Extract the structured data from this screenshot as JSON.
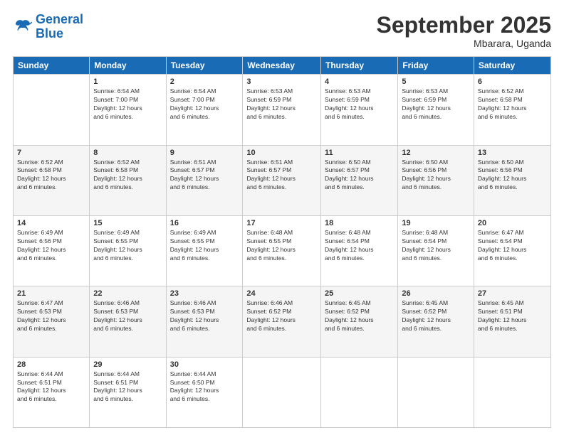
{
  "header": {
    "logo_line1": "General",
    "logo_line2": "Blue",
    "month": "September 2025",
    "location": "Mbarara, Uganda"
  },
  "weekdays": [
    "Sunday",
    "Monday",
    "Tuesday",
    "Wednesday",
    "Thursday",
    "Friday",
    "Saturday"
  ],
  "weeks": [
    [
      {
        "day": "",
        "info": ""
      },
      {
        "day": "1",
        "info": "Sunrise: 6:54 AM\nSunset: 7:00 PM\nDaylight: 12 hours\nand 6 minutes."
      },
      {
        "day": "2",
        "info": "Sunrise: 6:54 AM\nSunset: 7:00 PM\nDaylight: 12 hours\nand 6 minutes."
      },
      {
        "day": "3",
        "info": "Sunrise: 6:53 AM\nSunset: 6:59 PM\nDaylight: 12 hours\nand 6 minutes."
      },
      {
        "day": "4",
        "info": "Sunrise: 6:53 AM\nSunset: 6:59 PM\nDaylight: 12 hours\nand 6 minutes."
      },
      {
        "day": "5",
        "info": "Sunrise: 6:53 AM\nSunset: 6:59 PM\nDaylight: 12 hours\nand 6 minutes."
      },
      {
        "day": "6",
        "info": "Sunrise: 6:52 AM\nSunset: 6:58 PM\nDaylight: 12 hours\nand 6 minutes."
      }
    ],
    [
      {
        "day": "7",
        "info": "Sunrise: 6:52 AM\nSunset: 6:58 PM\nDaylight: 12 hours\nand 6 minutes."
      },
      {
        "day": "8",
        "info": "Sunrise: 6:52 AM\nSunset: 6:58 PM\nDaylight: 12 hours\nand 6 minutes."
      },
      {
        "day": "9",
        "info": "Sunrise: 6:51 AM\nSunset: 6:57 PM\nDaylight: 12 hours\nand 6 minutes."
      },
      {
        "day": "10",
        "info": "Sunrise: 6:51 AM\nSunset: 6:57 PM\nDaylight: 12 hours\nand 6 minutes."
      },
      {
        "day": "11",
        "info": "Sunrise: 6:50 AM\nSunset: 6:57 PM\nDaylight: 12 hours\nand 6 minutes."
      },
      {
        "day": "12",
        "info": "Sunrise: 6:50 AM\nSunset: 6:56 PM\nDaylight: 12 hours\nand 6 minutes."
      },
      {
        "day": "13",
        "info": "Sunrise: 6:50 AM\nSunset: 6:56 PM\nDaylight: 12 hours\nand 6 minutes."
      }
    ],
    [
      {
        "day": "14",
        "info": "Sunrise: 6:49 AM\nSunset: 6:56 PM\nDaylight: 12 hours\nand 6 minutes."
      },
      {
        "day": "15",
        "info": "Sunrise: 6:49 AM\nSunset: 6:55 PM\nDaylight: 12 hours\nand 6 minutes."
      },
      {
        "day": "16",
        "info": "Sunrise: 6:49 AM\nSunset: 6:55 PM\nDaylight: 12 hours\nand 6 minutes."
      },
      {
        "day": "17",
        "info": "Sunrise: 6:48 AM\nSunset: 6:55 PM\nDaylight: 12 hours\nand 6 minutes."
      },
      {
        "day": "18",
        "info": "Sunrise: 6:48 AM\nSunset: 6:54 PM\nDaylight: 12 hours\nand 6 minutes."
      },
      {
        "day": "19",
        "info": "Sunrise: 6:48 AM\nSunset: 6:54 PM\nDaylight: 12 hours\nand 6 minutes."
      },
      {
        "day": "20",
        "info": "Sunrise: 6:47 AM\nSunset: 6:54 PM\nDaylight: 12 hours\nand 6 minutes."
      }
    ],
    [
      {
        "day": "21",
        "info": "Sunrise: 6:47 AM\nSunset: 6:53 PM\nDaylight: 12 hours\nand 6 minutes."
      },
      {
        "day": "22",
        "info": "Sunrise: 6:46 AM\nSunset: 6:53 PM\nDaylight: 12 hours\nand 6 minutes."
      },
      {
        "day": "23",
        "info": "Sunrise: 6:46 AM\nSunset: 6:53 PM\nDaylight: 12 hours\nand 6 minutes."
      },
      {
        "day": "24",
        "info": "Sunrise: 6:46 AM\nSunset: 6:52 PM\nDaylight: 12 hours\nand 6 minutes."
      },
      {
        "day": "25",
        "info": "Sunrise: 6:45 AM\nSunset: 6:52 PM\nDaylight: 12 hours\nand 6 minutes."
      },
      {
        "day": "26",
        "info": "Sunrise: 6:45 AM\nSunset: 6:52 PM\nDaylight: 12 hours\nand 6 minutes."
      },
      {
        "day": "27",
        "info": "Sunrise: 6:45 AM\nSunset: 6:51 PM\nDaylight: 12 hours\nand 6 minutes."
      }
    ],
    [
      {
        "day": "28",
        "info": "Sunrise: 6:44 AM\nSunset: 6:51 PM\nDaylight: 12 hours\nand 6 minutes."
      },
      {
        "day": "29",
        "info": "Sunrise: 6:44 AM\nSunset: 6:51 PM\nDaylight: 12 hours\nand 6 minutes."
      },
      {
        "day": "30",
        "info": "Sunrise: 6:44 AM\nSunset: 6:50 PM\nDaylight: 12 hours\nand 6 minutes."
      },
      {
        "day": "",
        "info": ""
      },
      {
        "day": "",
        "info": ""
      },
      {
        "day": "",
        "info": ""
      },
      {
        "day": "",
        "info": ""
      }
    ]
  ]
}
